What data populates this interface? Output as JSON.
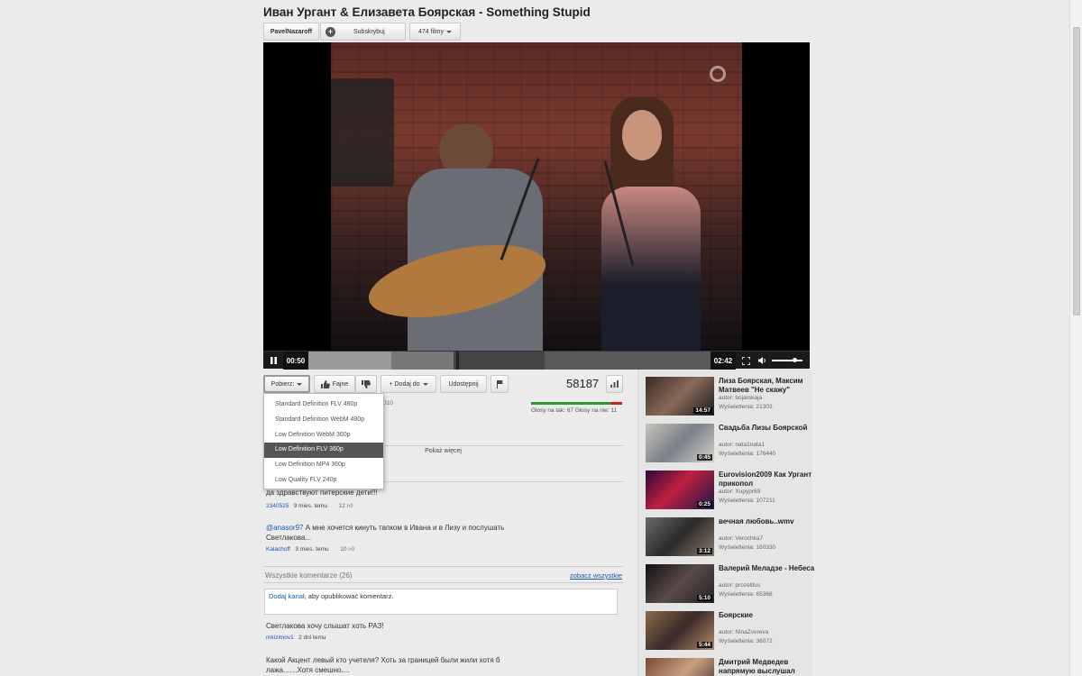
{
  "video": {
    "title": "Иван Ургант & Елизавета Боярская - Something Stupid",
    "channel": "PavelNazaroff",
    "subscribe_label": "Subskrybuj",
    "films_label": "474 filmy",
    "current_time": "00:50",
    "duration": "02:42",
    "progress": 0.206,
    "buffered": 0.36
  },
  "actions": {
    "download_label": "Pobierz:",
    "like_label": "Fajne",
    "add_to_label": "Dodaj do",
    "share_label": "Udostępnij",
    "view_count": "58187",
    "votes_text": "Głosy na tak: 67 Głosy na nie: 11",
    "upload_date_fragment": "010",
    "show_more_label": "Pokaż więcej"
  },
  "download_menu": {
    "selected_index": 3,
    "items": [
      "Standard Definition FLV 480p",
      "Standard Definition WebM 480p",
      "Low Definition WebM 360p",
      "Low Definition FLV 360p",
      "Low Definition MP4 360p",
      "Low Quality FLV 240p"
    ]
  },
  "top_comments": [
    {
      "text": "да здравствуют питерские дети!!!",
      "author": "2340525",
      "time": "9 mies. temu",
      "likes": "12"
    },
    {
      "mention": "@anasor97",
      "text": " А мне хочется кинуть тапком в Ивана и в Лизу и послушать Светлакова...",
      "author": "Kalachoff",
      "time": "3 mies. temu",
      "likes": "10"
    }
  ],
  "all_comments": {
    "header": "Wszystkie komentarze (26)",
    "see_all": "zobacz wszystkie",
    "add_channel_link": "Dodaj kanał",
    "add_channel_rest": ", aby opublikować komentarz.",
    "items": [
      {
        "text": "Светлакова хочу слышат хоть РАЗ!",
        "author": "mkizimov1",
        "time": "2 dni temu"
      },
      {
        "text": "Какой Акцент левый кто учетеля? Хоть за границей были жили хотя б лажа.......Хотя смешно....",
        "author": "",
        "time": ""
      }
    ]
  },
  "related": [
    {
      "title": "Лиза Боярская, Максим Матвеев \"Не скажу\"",
      "author": "autor: bojarskaja",
      "views": "Wyświetlenia: 21303",
      "duration": "14:57"
    },
    {
      "title": "Свадьба Лизы Боярской",
      "author": "autor: nata1nata1",
      "views": "Wyświetlenia: 176440",
      "duration": "0:45"
    },
    {
      "title": "Eurovision2009 Как Ургант прикопол",
      "author": "autor: Xupypr69",
      "views": "Wyświetlenia: 107211",
      "duration": "0:25"
    },
    {
      "title": "вечная любовь..wmv",
      "author": "autor: Verochka7",
      "views": "Wyświetlenia: 160330",
      "duration": "3:12"
    },
    {
      "title": "Валерий Меладзе - Небеса",
      "author": "autor: prozelitus",
      "views": "Wyświetlenia: 65368",
      "duration": "5:10"
    },
    {
      "title": "Боярские",
      "author": "autor: NinaZvereva",
      "views": "Wyświetlenia: 36072",
      "duration": "5:44"
    },
    {
      "title": "Дмитрий Медведев напрямую выcлушал",
      "author": "",
      "views": "",
      "duration": ""
    }
  ],
  "colors": {
    "like_bar": "#2a9a2a",
    "dislike_bar": "#cc2222",
    "link": "#1a58b5",
    "menu_selected": "#555555"
  }
}
